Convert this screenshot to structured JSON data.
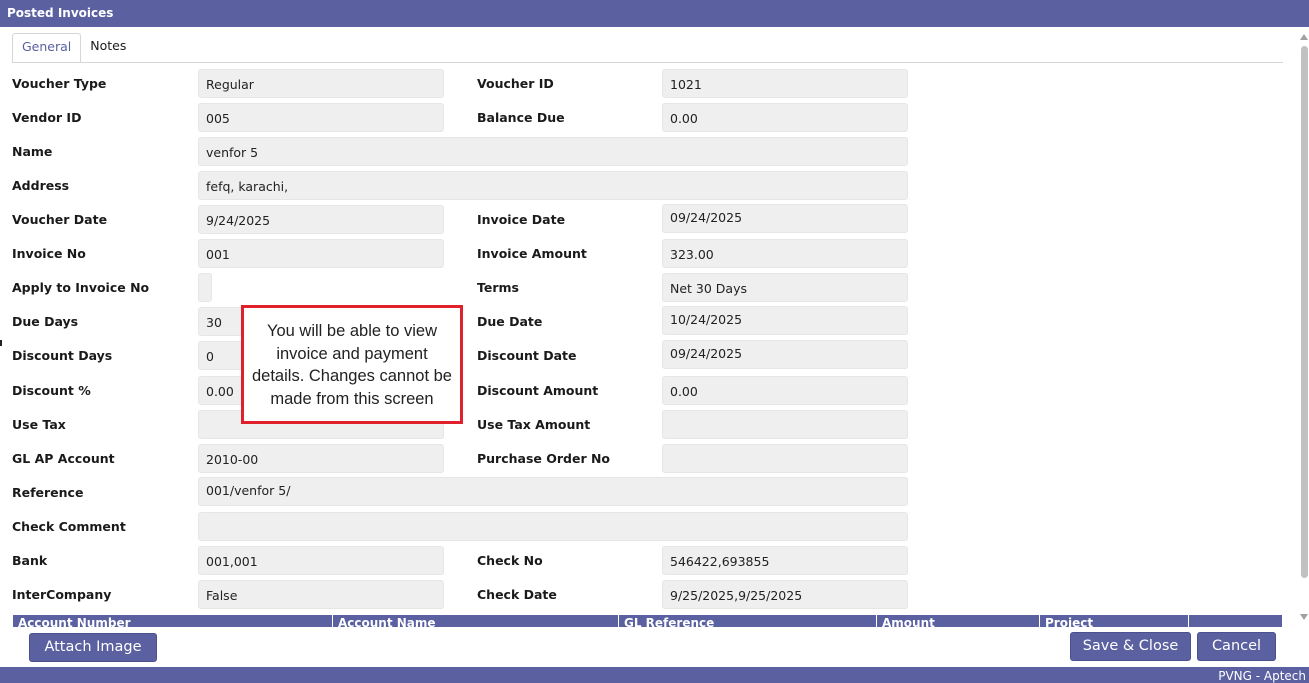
{
  "window": {
    "title": "Posted Invoices"
  },
  "tabs": [
    {
      "label": "General",
      "active": true
    },
    {
      "label": "Notes",
      "active": false
    }
  ],
  "fields": {
    "voucher_type": {
      "label": "Voucher Type",
      "value": "Regular"
    },
    "voucher_id": {
      "label": "Voucher ID",
      "value": "1021"
    },
    "vendor_id": {
      "label": "Vendor ID",
      "value": "005"
    },
    "balance_due": {
      "label": "Balance Due",
      "value": "0.00"
    },
    "name": {
      "label": "Name",
      "value": "venfor 5"
    },
    "address": {
      "label": "Address",
      "value": "fefq, karachi,"
    },
    "voucher_date": {
      "label": "Voucher Date",
      "value": "9/24/2025"
    },
    "invoice_date": {
      "label": "Invoice Date",
      "value": "09/24/2025"
    },
    "invoice_no": {
      "label": "Invoice No",
      "value": "001"
    },
    "invoice_amount": {
      "label": "Invoice Amount",
      "value": "323.00"
    },
    "apply_to_invoice_no": {
      "label": "Apply to Invoice No",
      "value": ""
    },
    "terms": {
      "label": "Terms",
      "value": "Net 30 Days"
    },
    "due_days": {
      "label": "Due Days",
      "value": "30"
    },
    "due_date": {
      "label": "Due Date",
      "value": "10/24/2025"
    },
    "discount_days": {
      "label": "Discount Days",
      "value": "0"
    },
    "discount_date": {
      "label": "Discount Date",
      "value": "09/24/2025"
    },
    "discount_pct": {
      "label": "Discount %",
      "value": "0.00"
    },
    "discount_amount": {
      "label": "Discount Amount",
      "value": "0.00"
    },
    "use_tax": {
      "label": "Use Tax",
      "value": ""
    },
    "use_tax_amount": {
      "label": "Use Tax Amount",
      "value": ""
    },
    "gl_ap_account": {
      "label": "GL AP Account",
      "value": "2010-00"
    },
    "purchase_order_no": {
      "label": "Purchase Order No",
      "value": ""
    },
    "reference": {
      "label": "Reference",
      "value": "001/venfor 5/"
    },
    "check_comment": {
      "label": "Check Comment",
      "value": ""
    },
    "bank": {
      "label": "Bank",
      "value": "001,001"
    },
    "check_no": {
      "label": "Check No",
      "value": "546422,693855"
    },
    "intercompany": {
      "label": "InterCompany",
      "value": "False"
    },
    "check_date": {
      "label": "Check Date",
      "value": "9/25/2025,9/25/2025"
    }
  },
  "grid": {
    "columns": [
      "Account Number",
      "Account Name",
      "GL Reference",
      "Amount",
      "Project",
      ""
    ]
  },
  "callout": {
    "lines": [
      "You will be able to view",
      "invoice and payment",
      "details. Changes cannot be",
      "made from this screen"
    ]
  },
  "buttons": {
    "attach_image": "Attach Image",
    "save_close": "Save & Close",
    "cancel": "Cancel"
  },
  "footer": {
    "text": "PVNG - Aptech"
  },
  "colors": {
    "accent": "#5a60a0",
    "field_bg": "#efefef",
    "callout_border": "#e0202a"
  }
}
